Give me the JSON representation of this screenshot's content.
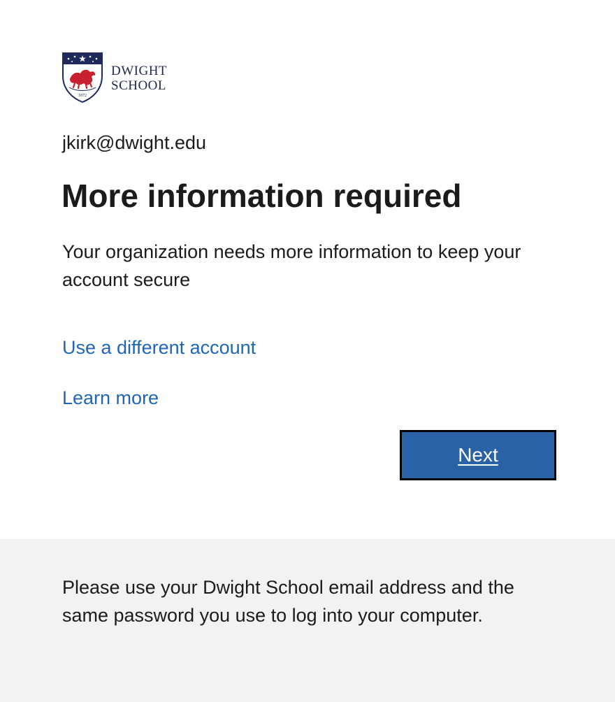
{
  "brand": {
    "name_line1": "DWIGHT",
    "name_line2": "SCHOOL",
    "crest_year": "1872"
  },
  "account": {
    "email": "jkirk@dwight.edu"
  },
  "heading": {
    "title": "More information required",
    "description": "Your organization needs more information to keep your account secure"
  },
  "links": {
    "different_account": "Use a different account",
    "learn_more": "Learn more"
  },
  "actions": {
    "next_label": "Next"
  },
  "footer": {
    "text": "Please use your Dwight School email address and the same password you use to log into your computer."
  },
  "colors": {
    "link": "#1f67b5",
    "button_bg": "#2a62a6",
    "footer_bg": "#f2f2f2",
    "crest_navy": "#1f2a5a",
    "crest_red": "#c8202f"
  }
}
